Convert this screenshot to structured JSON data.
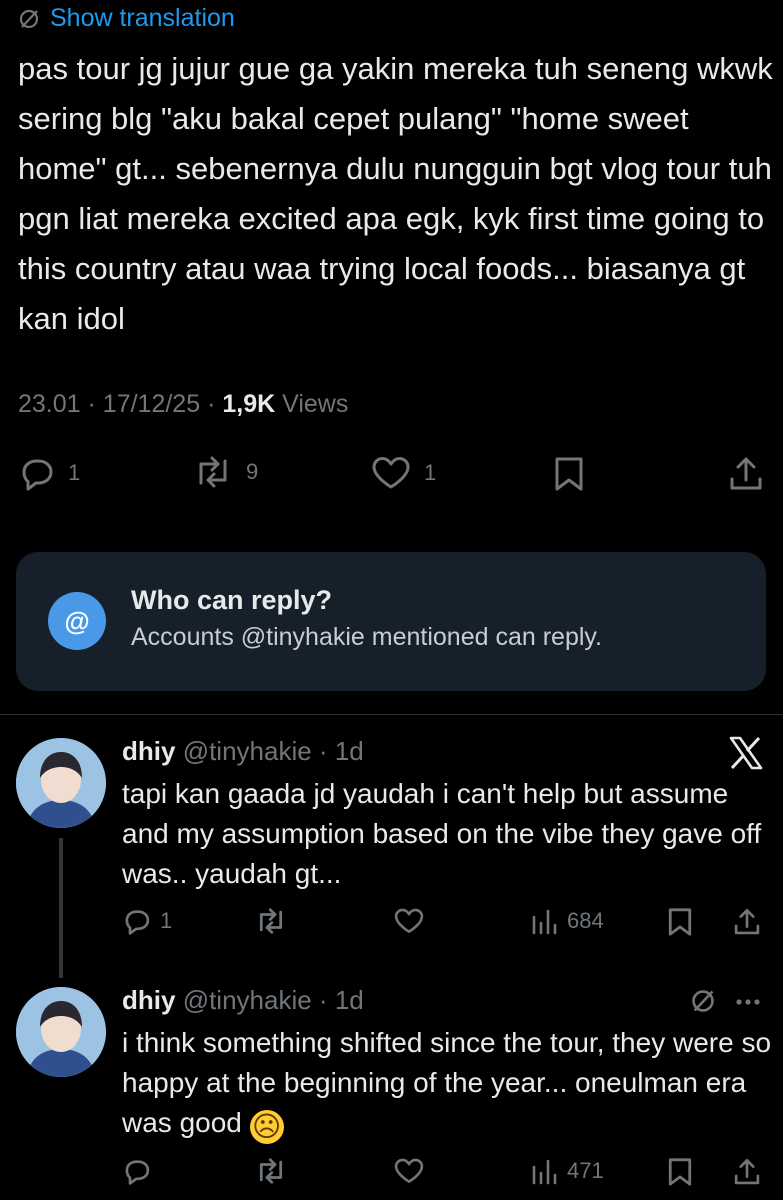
{
  "tweet": {
    "show_translation": "Show translation",
    "text": "pas tour jg jujur gue ga yakin mereka tuh seneng wkwk sering blg \"aku bakal cepet pulang\" \"home sweet home\" gt... sebenernya dulu nungguin bgt vlog tour tuh pgn liat mereka excited apa egk, kyk first time going to this country atau waa trying local foods... biasanya gt kan idol",
    "time": "23.01",
    "date": "17/12/25",
    "views_count": "1,9K",
    "views_label": "Views",
    "replies": "1",
    "reposts": "9",
    "likes": "1"
  },
  "who_can_reply": {
    "title": "Who can reply?",
    "subtitle": "Accounts @tinyhakie mentioned can reply.",
    "icon_glyph": "@"
  },
  "replies": [
    {
      "name": "dhiy",
      "handle": "@tinyhakie",
      "age": "1d",
      "text": "tapi kan gaada jd yaudah i can't help but assume and my assumption based on the vibe they gave off was.. yaudah gt...",
      "reply_count": "1",
      "views": "684"
    },
    {
      "name": "dhiy",
      "handle": "@tinyhakie",
      "age": "1d",
      "text": "i think something shifted since the tour, they were so happy at the beginning of the year... oneulman era was good",
      "emoji": "☹",
      "views": "471"
    }
  ],
  "colors": {
    "background": "#000000",
    "link_blue": "#1d9bf0",
    "reply_box": "#16202a",
    "at_circle": "#4a99e9",
    "muted": "#71767b"
  }
}
